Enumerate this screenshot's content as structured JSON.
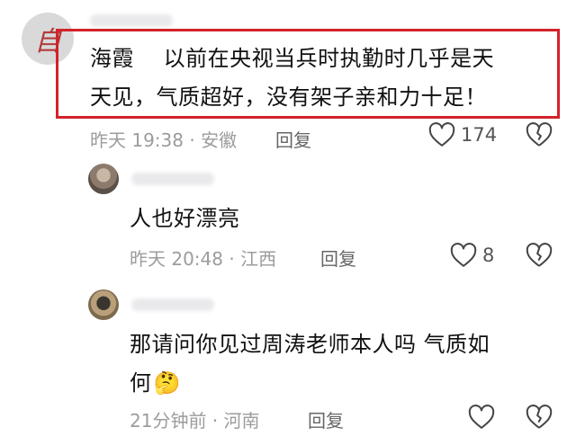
{
  "colors": {
    "highlight_border": "#d2232a",
    "meta_text": "#9c9c9c",
    "icon_stroke": "#444444"
  },
  "comments": [
    {
      "text_line1": "海霞　 以前在央视当兵时执勤时几乎是天",
      "text_line2": "天见，气质超好，没有架子亲和力十足！",
      "time": "昨天 19:38",
      "location": "安徽",
      "reply_label": "回复",
      "likes": "174",
      "avatar_glyph": "自",
      "highlighted": true
    },
    {
      "text_line1": "人也好漂亮",
      "time": "昨天 20:48",
      "location": "江西",
      "reply_label": "回复",
      "likes": "8"
    },
    {
      "text_line1": "那请问你见过周涛老师本人吗 气质如",
      "text_line2": "何",
      "emoji": "🤔",
      "time": "21分钟前",
      "location": "河南",
      "reply_label": "回复",
      "likes": ""
    }
  ]
}
